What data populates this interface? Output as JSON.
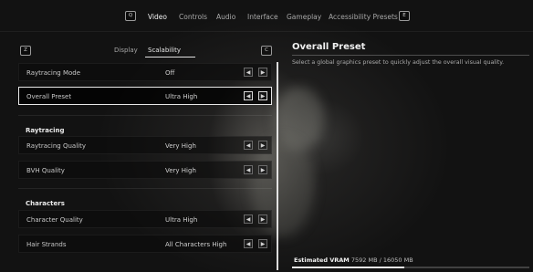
{
  "nav": {
    "left_key": "Q",
    "right_key": "E",
    "tabs": [
      "Video",
      "Controls",
      "Audio",
      "Interface",
      "Gameplay",
      "Accessibility Presets"
    ],
    "active_tab": "Video"
  },
  "subnav": {
    "left_key": "Z",
    "right_key": "C",
    "tabs": [
      "Display",
      "Scalability"
    ],
    "active_tab": "Scalability"
  },
  "settings": {
    "raytracing_mode": {
      "label": "Raytracing Mode",
      "value": "Off"
    },
    "overall_preset": {
      "label": "Overall Preset",
      "value": "Ultra High"
    },
    "section_raytracing": "Raytracing",
    "raytracing_quality": {
      "label": "Raytracing Quality",
      "value": "Very High"
    },
    "bvh_quality": {
      "label": "BVH Quality",
      "value": "Very High"
    },
    "section_characters": "Characters",
    "character_quality": {
      "label": "Character Quality",
      "value": "Ultra High"
    },
    "hair_strands": {
      "label": "Hair Strands",
      "value": "All Characters High"
    }
  },
  "panel": {
    "title": "Overall Preset",
    "description": "Select a global graphics preset to quickly adjust the overall visual quality."
  },
  "vram": {
    "label": "Estimated VRAM",
    "value": "7592 MB / 16050 MB",
    "fraction": 0.473
  },
  "icons": {
    "left": "chevron-left",
    "right": "chevron-right"
  }
}
